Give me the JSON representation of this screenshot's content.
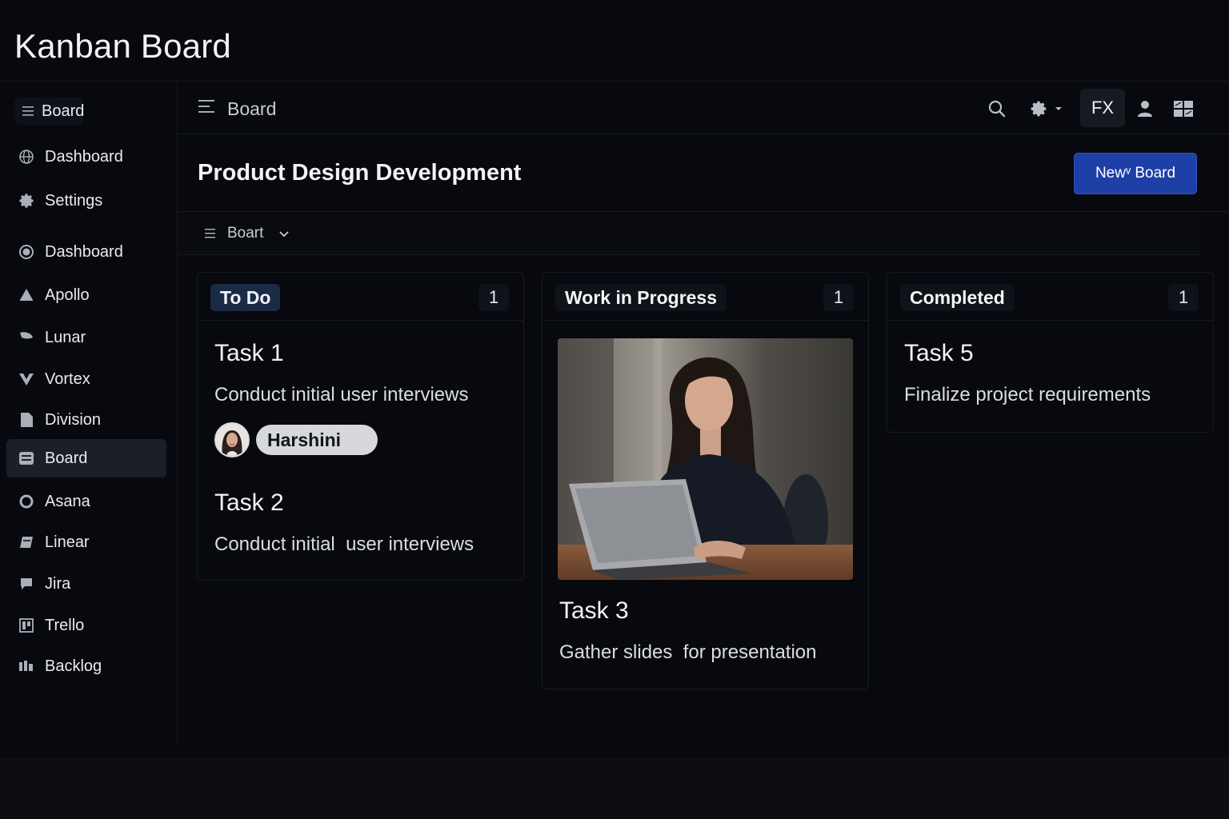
{
  "app": {
    "title": "Kanban Board"
  },
  "sidebar": {
    "items": [
      {
        "label": "Board",
        "icon": "menu-icon"
      },
      {
        "label": "Dashboard",
        "icon": "globe-icon"
      },
      {
        "label": "Settings",
        "icon": "gear-icon"
      },
      {
        "label": "Dashboard",
        "icon": "circle-icon"
      },
      {
        "label": "Apollo",
        "icon": "triangle-icon"
      },
      {
        "label": "Lunar",
        "icon": "leaf-icon"
      },
      {
        "label": "Vortex",
        "icon": "vortex-icon"
      },
      {
        "label": "Division",
        "icon": "document-icon"
      },
      {
        "label": "Board",
        "icon": "board-icon",
        "active": true
      },
      {
        "label": "Asana",
        "icon": "ring-icon"
      },
      {
        "label": "Linear",
        "icon": "linear-icon"
      },
      {
        "label": "Jira",
        "icon": "chat-icon"
      },
      {
        "label": "Trello",
        "icon": "trello-icon"
      },
      {
        "label": "Backlog",
        "icon": "backlog-icon"
      }
    ]
  },
  "topbar": {
    "title": "Board",
    "user_initials": "FX"
  },
  "page": {
    "title": "Product Design Development",
    "new_board_label": "New⁠ᵛ Board"
  },
  "subbar": {
    "view_label": "Boart"
  },
  "columns": [
    {
      "title": "To Do",
      "count": "1",
      "cards": [
        {
          "title": "Task 1",
          "description": "Conduct initial user interviews",
          "assignee": "Harshini"
        },
        {
          "title": "Task 2",
          "description": "Conduct initial  user interviews"
        }
      ]
    },
    {
      "title": "Work in Progress",
      "count": "1",
      "cards": [
        {
          "title": "Task 3",
          "description": "Gather slides  for presentation"
        }
      ]
    },
    {
      "title": "Completed",
      "count": "1",
      "cards": [
        {
          "title": "Task 5",
          "description": "Finalize project requirements"
        }
      ]
    }
  ],
  "colors": {
    "accent": "#1e40a6",
    "background": "#07090e",
    "panel": "#161a21"
  }
}
